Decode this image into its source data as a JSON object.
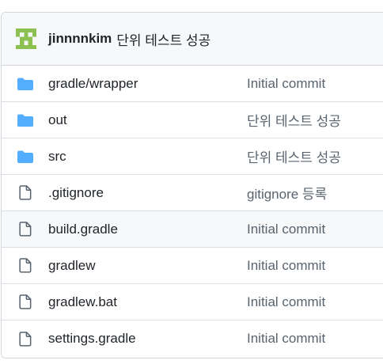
{
  "header": {
    "author": "jinnnnkim",
    "commit_message": "단위 테스트 성공",
    "avatar_icon": "identicon-avatar",
    "avatar_color": "#8cc152"
  },
  "colors": {
    "folder": "#54aeff",
    "file": "#59636e",
    "border": "#d0d7de",
    "header_bg": "#f6f8fa"
  },
  "files": [
    {
      "name": "gradle/wrapper",
      "message": "Initial commit",
      "type": "folder",
      "icon": "folder-icon"
    },
    {
      "name": "out",
      "message": "단위 테스트 성공",
      "type": "folder",
      "icon": "folder-icon"
    },
    {
      "name": "src",
      "message": "단위 테스트 성공",
      "type": "folder",
      "icon": "folder-icon"
    },
    {
      "name": ".gitignore",
      "message": "gitignore 등록",
      "type": "file",
      "icon": "file-icon"
    },
    {
      "name": "build.gradle",
      "message": "Initial commit",
      "type": "file",
      "icon": "file-icon",
      "hovered": true
    },
    {
      "name": "gradlew",
      "message": "Initial commit",
      "type": "file",
      "icon": "file-icon"
    },
    {
      "name": "gradlew.bat",
      "message": "Initial commit",
      "type": "file",
      "icon": "file-icon"
    },
    {
      "name": "settings.gradle",
      "message": "Initial commit",
      "type": "file",
      "icon": "file-icon"
    }
  ]
}
